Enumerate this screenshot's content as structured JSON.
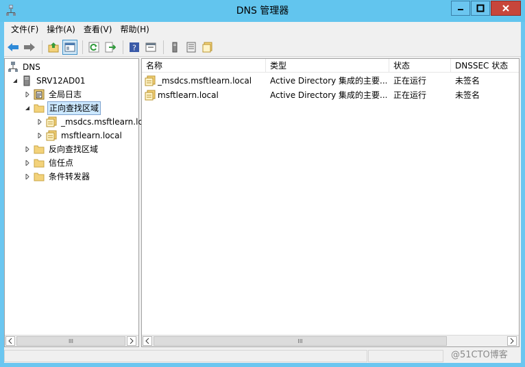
{
  "window": {
    "title": "DNS 管理器"
  },
  "menu": [
    "文件(F)",
    "操作(A)",
    "查看(V)",
    "帮助(H)"
  ],
  "toolbar": [
    "back-icon",
    "forward-icon",
    "up-folder-icon",
    "show-hide-tree-icon",
    "refresh-icon",
    "export-list-icon",
    "help-icon",
    "properties-icon",
    "server-icon",
    "zone-list-icon",
    "zone-folder-icon"
  ],
  "tree": {
    "root": "DNS",
    "server": "SRV12AD01",
    "global_log": "全局日志",
    "forward_zones": "正向查找区域",
    "fz_child1": "_msdcs.msftlearn.lc",
    "fz_child2": "msftlearn.local",
    "reverse_zones": "反向查找区域",
    "trust_points": "信任点",
    "conditional_forwarders": "条件转发器"
  },
  "list": {
    "columns": [
      "名称",
      "类型",
      "状态",
      "DNSSEC 状态"
    ],
    "rows": [
      {
        "name": "_msdcs.msftlearn.local",
        "type": "Active Directory 集成的主要...",
        "status": "正在运行",
        "dnssec": "未签名"
      },
      {
        "name": "msftlearn.local",
        "type": "Active Directory 集成的主要...",
        "status": "正在运行",
        "dnssec": "未签名"
      }
    ]
  },
  "scroll": {
    "thumb_glyph": "III"
  },
  "watermark": "@51CTO博客",
  "colors": {
    "titlebar": "#62c5ee",
    "close": "#c7463b",
    "selection": "#cce8ff",
    "folder": "#f3d27a"
  }
}
